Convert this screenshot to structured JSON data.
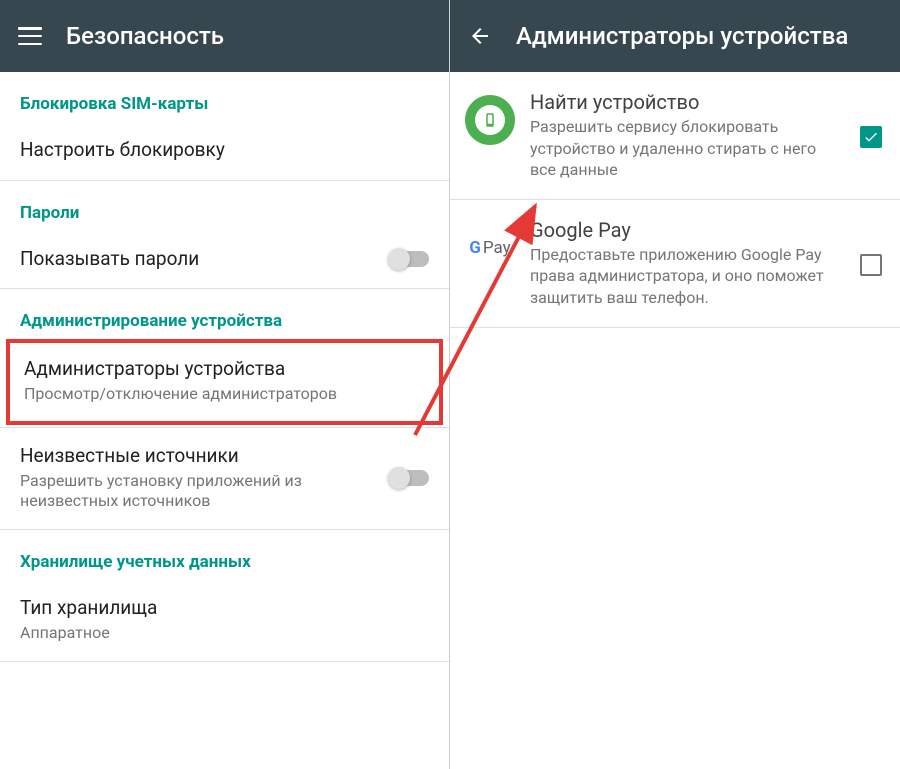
{
  "left": {
    "title": "Безопасность",
    "sections": {
      "sim_lock": "Блокировка SIM-карты",
      "passwords": "Пароли",
      "device_admin": "Администрирование устройства",
      "credential_storage": "Хранилище учетных данных"
    },
    "items": {
      "configure_lock": "Настроить блокировку",
      "show_passwords": "Показывать пароли",
      "device_administrators": {
        "title": "Администраторы устройства",
        "subtitle": "Просмотр/отключение администраторов"
      },
      "unknown_sources": {
        "title": "Неизвестные источники",
        "subtitle": "Разрешить установку приложений из неизвестных источников"
      },
      "storage_type": {
        "title": "Тип хранилища",
        "subtitle": "Аппаратное"
      }
    }
  },
  "right": {
    "title": "Администраторы устройства",
    "items": [
      {
        "title": "Найти устройство",
        "subtitle": "Разрешить сервису блокировать устройство и удаленно стирать с него все данные",
        "checked": true
      },
      {
        "title": "Google Pay",
        "subtitle": "Предоставьте приложению Google Pay права администратора, и оно поможет защитить ваш телефон.",
        "checked": false
      }
    ]
  },
  "colors": {
    "appbar": "#37474f",
    "accent": "#009688",
    "highlight": "#e53935"
  }
}
